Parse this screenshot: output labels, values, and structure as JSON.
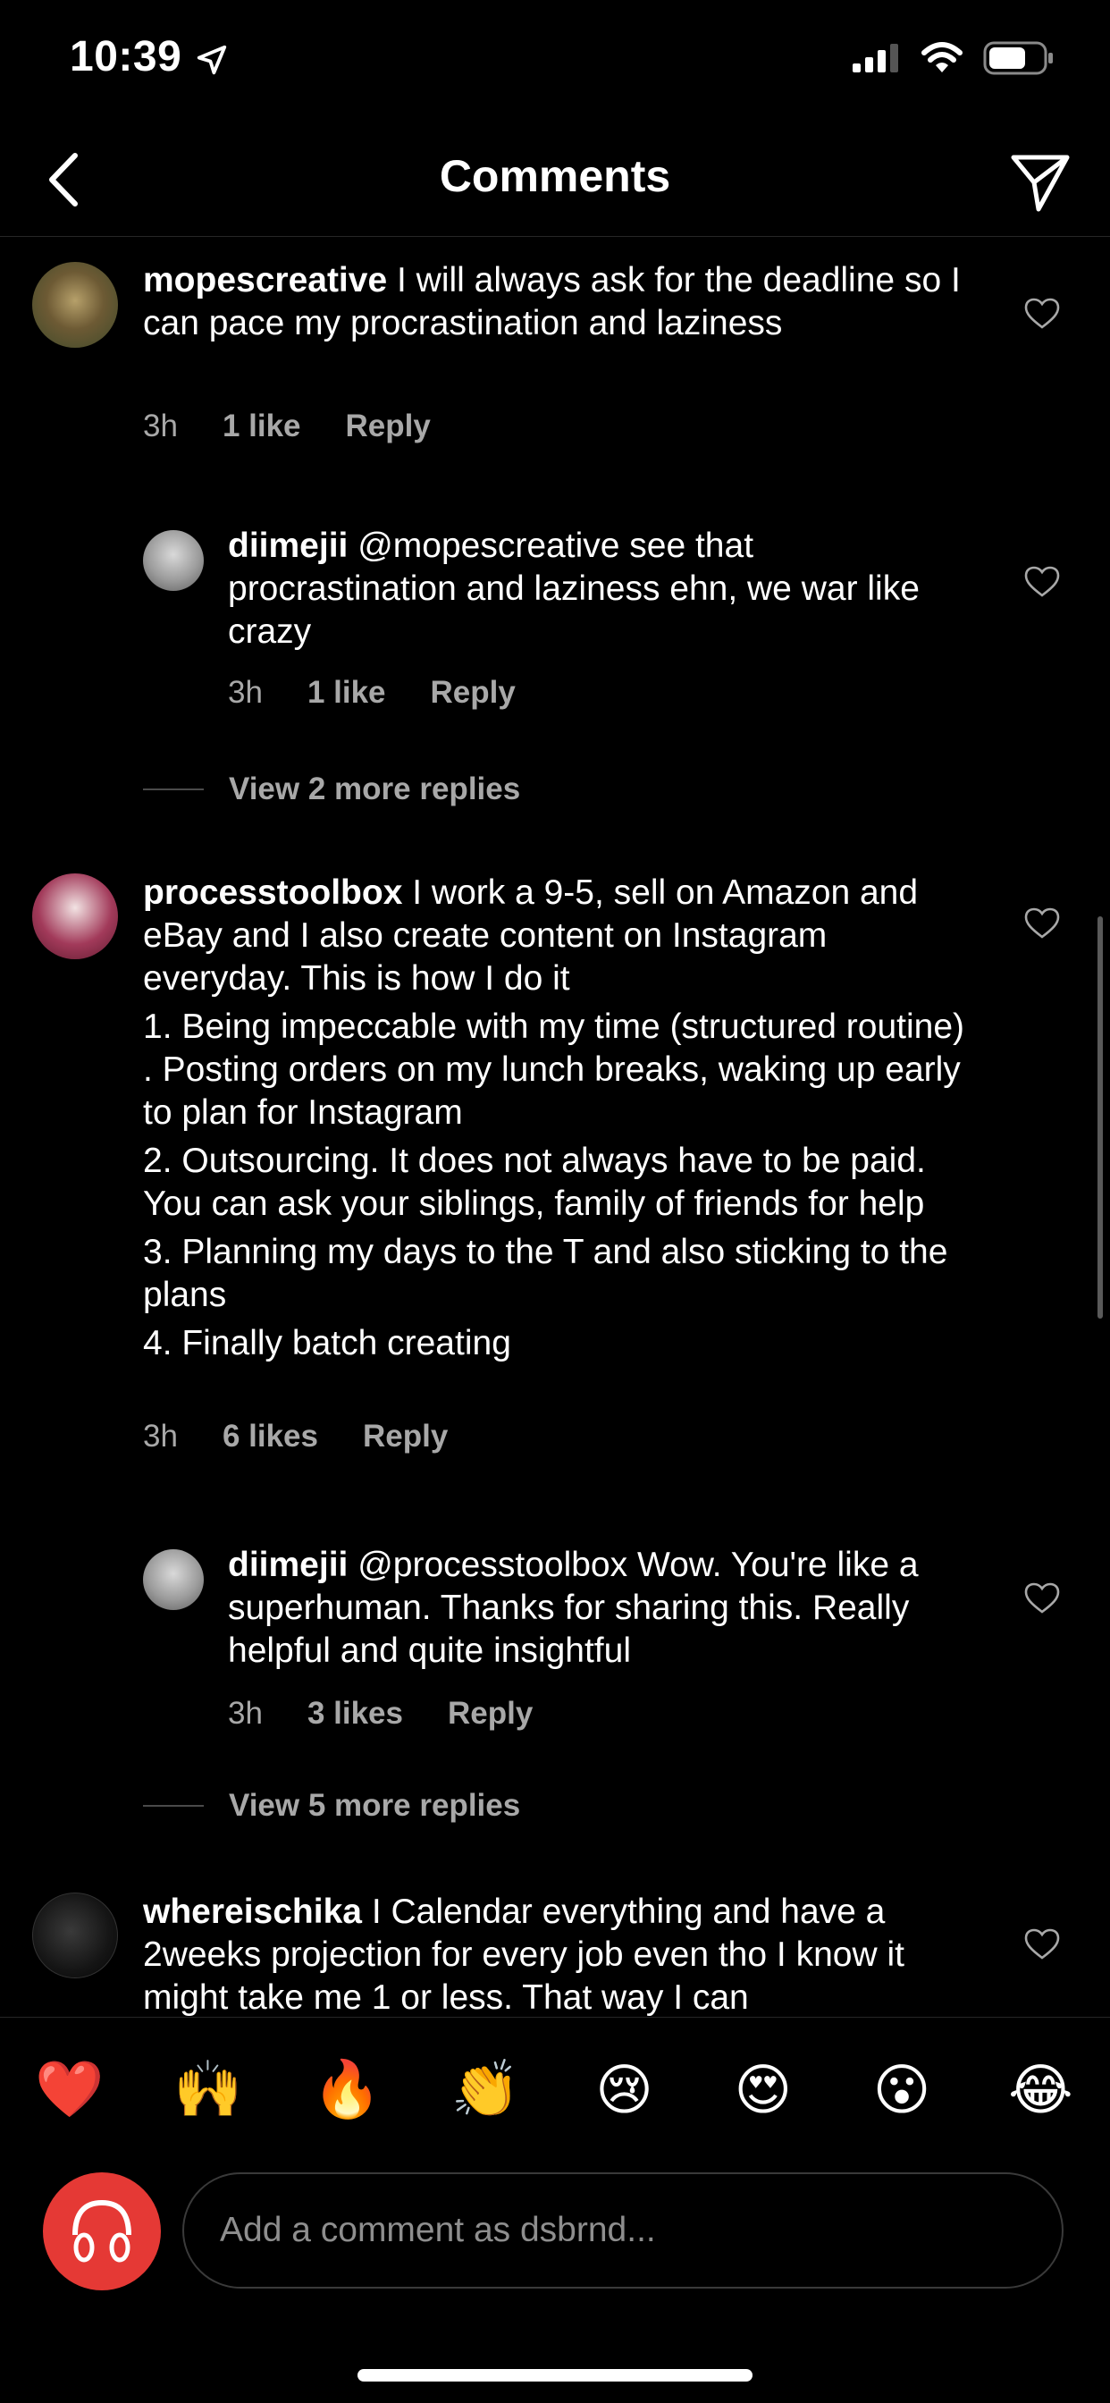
{
  "status": {
    "time": "10:39"
  },
  "header": {
    "title": "Comments"
  },
  "comments": [
    {
      "username": "mopescreative",
      "text": "I will always ask for the deadline so I can pace my procrastination and laziness",
      "time": "3h",
      "likes": "1 like",
      "reply": "Reply"
    },
    {
      "username": "diimejii",
      "text": "@mopescreative see that procrastination and laziness ehn, we war like crazy",
      "time": "3h",
      "likes": "1 like",
      "reply": "Reply"
    },
    {
      "view_more": "View 2 more replies"
    },
    {
      "username": "processtoolbox",
      "text": "I work a 9-5, sell on Amazon and eBay and I also create content on Instagram everyday. This is how I do it",
      "lines": [
        "1. Being impeccable with my time (structured routine) . Posting orders on my lunch breaks, waking up early to plan for Instagram",
        "2. Outsourcing. It does not always have to be paid. You can ask your siblings, family of friends for help",
        "3. Planning my days to the T and also sticking to the plans",
        "4. Finally batch creating"
      ],
      "time": "3h",
      "likes": "6 likes",
      "reply": "Reply"
    },
    {
      "username": "diimejii",
      "text": "@processtoolbox Wow. You're like a superhuman. Thanks for sharing this. Really helpful and quite insightful",
      "time": "3h",
      "likes": "3 likes",
      "reply": "Reply"
    },
    {
      "view_more": "View 5 more replies"
    },
    {
      "username": "whereischika",
      "text": "I Calendar everything and have a 2weeks projection for every job even tho I know it might take me 1 or less. That way I can"
    }
  ],
  "emoji_bar": [
    "❤️",
    "🙌",
    "🔥",
    "👏",
    "😢",
    "😍",
    "😮",
    "😂"
  ],
  "composer": {
    "placeholder": "Add a comment as dsbrnd..."
  },
  "colors": {
    "background": "#000000",
    "muted": "#a8a8a8",
    "divider": "#262626"
  }
}
